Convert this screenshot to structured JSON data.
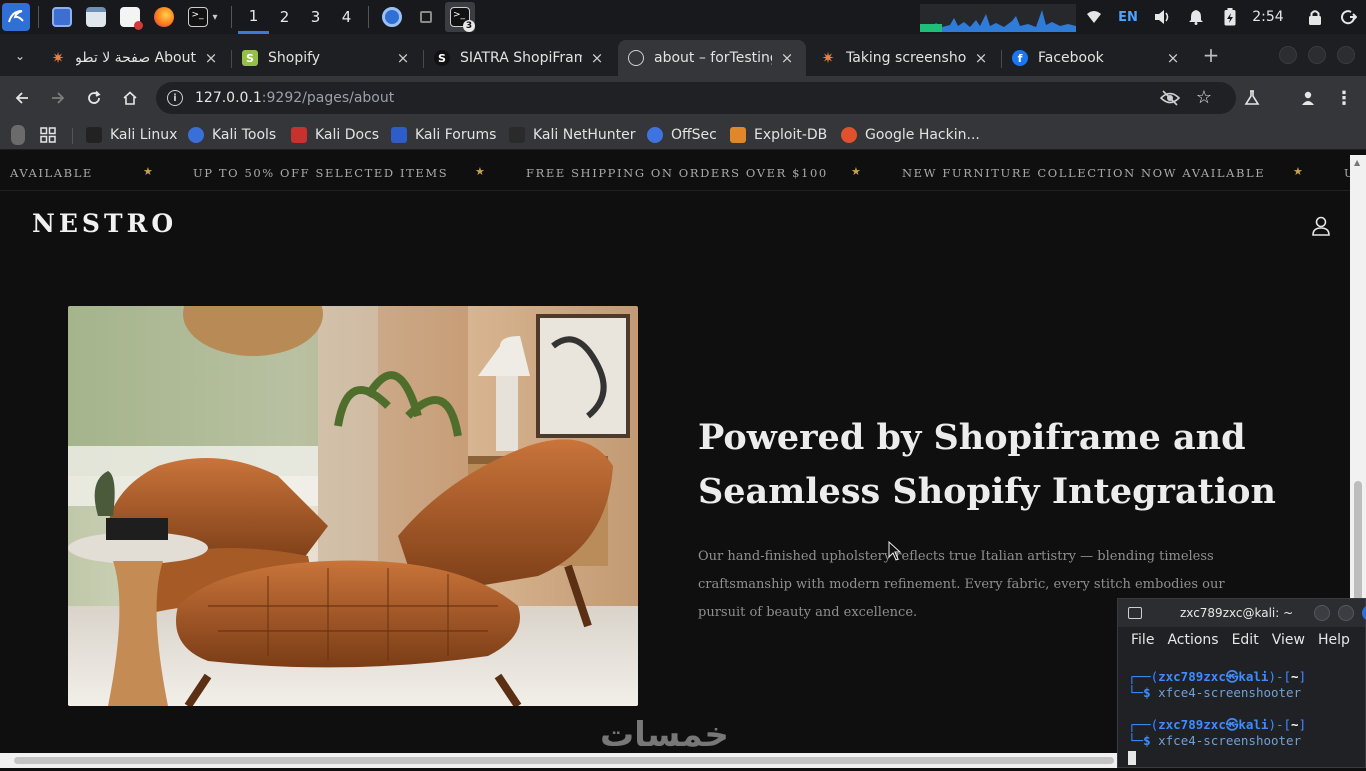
{
  "os_panel": {
    "workspaces": [
      "1",
      "2",
      "3",
      "4"
    ],
    "active_workspace": "1",
    "terminal_badge": "3",
    "language": "EN",
    "clock": "2:54",
    "icons": [
      "kali-menu-icon",
      "desktop-icon",
      "file-manager-icon",
      "text-editor-icon",
      "firefox-icon",
      "terminal-icon",
      "chromium-icon",
      "window-icon",
      "terminal-active-icon",
      "network-icon",
      "volume-icon",
      "notification-icon",
      "power-icon",
      "lock-icon",
      "logout-icon"
    ]
  },
  "browser": {
    "tabs": [
      {
        "label": "About صفحة لا تطو",
        "active": false
      },
      {
        "label": "Shopify",
        "active": false
      },
      {
        "label": "SIATRA ShopiFram",
        "active": false
      },
      {
        "label": "about – forTesting",
        "active": true
      },
      {
        "label": "Taking screenshot",
        "active": false
      },
      {
        "label": "Facebook",
        "active": false
      }
    ],
    "close_glyph": "×",
    "new_tab_glyph": "+",
    "url_host": "127.0.0.1",
    "url_path": ":9292/pages/about",
    "bookmarks": [
      "Kali Linux",
      "Kali Tools",
      "Kali Docs",
      "Kali Forums",
      "Kali NetHunter",
      "OffSec",
      "Exploit-DB",
      "Google Hackin..."
    ]
  },
  "page": {
    "marquee": [
      "AVAILABLE",
      "UP TO 50% OFF SELECTED ITEMS",
      "FREE SHIPPING ON ORDERS OVER $100",
      "NEW FURNITURE COLLECTION NOW AVAILABLE",
      "U"
    ],
    "marquee_separator": "★",
    "logo": "NESTRO",
    "hero_title": "Powered by Shopiframe and Seamless Shopify Integration",
    "hero_body": "Our hand-finished upholstery reflects true Italian artistry — blending timeless craftsmanship with modern refinement. Every fabric, every stitch embodies our pursuit of beauty and excellence.",
    "watermark": "خمسات"
  },
  "terminal": {
    "title": "zxc789zxc@kali: ~",
    "menu": [
      "File",
      "Actions",
      "Edit",
      "View",
      "Help"
    ],
    "prompt_user": "zxc789zxc",
    "prompt_at": "㉿",
    "prompt_host": "kali",
    "prompt_dir": "~",
    "commands": [
      "xfce4-screenshooter",
      "xfce4-screenshooter"
    ]
  },
  "colors": {
    "page_bg": "#0f0f10",
    "accent_gold": "#c9a24a",
    "terminal_blue": "#3f8cff",
    "tab_active": "#35363a"
  }
}
